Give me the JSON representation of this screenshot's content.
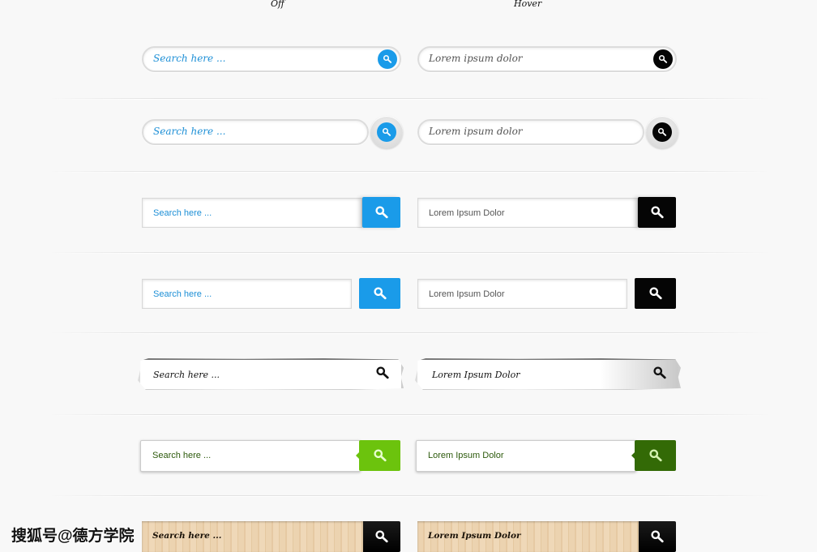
{
  "headers": {
    "off": "Off",
    "hover": "Hover"
  },
  "colors": {
    "blue": "#1a9be9",
    "black": "#050505",
    "green_off": "#6cc30d",
    "green_hover": "#336a06",
    "text_blue": "#1d8fd6",
    "text_gray": "#555555",
    "text_green": "#2d5a0c"
  },
  "rows": [
    {
      "style": "pill-inner-button",
      "off": {
        "text": "Search here ...",
        "icon": "search-icon"
      },
      "hover": {
        "text": "Lorem ipsum dolor",
        "icon": "search-icon"
      }
    },
    {
      "style": "pill-outer-round-button",
      "off": {
        "text": "Search here ...",
        "icon": "search-icon"
      },
      "hover": {
        "text": "Lorem ipsum dolor",
        "icon": "search-icon"
      }
    },
    {
      "style": "flat-attached-button",
      "off": {
        "text": "Search here ...",
        "icon": "search-icon"
      },
      "hover": {
        "text": "Lorem Ipsum Dolor",
        "icon": "search-icon"
      }
    },
    {
      "style": "flat-detached-button",
      "off": {
        "text": "Search here ...",
        "icon": "search-icon"
      },
      "hover": {
        "text": "Lorem Ipsum Dolor",
        "icon": "search-icon"
      }
    },
    {
      "style": "torn-paper",
      "off": {
        "text": "Search here ...",
        "icon": "search-icon"
      },
      "hover": {
        "text": "Lorem Ipsum Dolor",
        "icon": "search-icon"
      }
    },
    {
      "style": "green-arrow-button",
      "off": {
        "text": "Search here ...",
        "icon": "search-icon"
      },
      "hover": {
        "text": "Lorem Ipsum Dolor",
        "icon": "search-icon"
      }
    },
    {
      "style": "wood",
      "off": {
        "text": "Search here ...",
        "icon": "search-icon"
      },
      "hover": {
        "text": "Lorem Ipsum Dolor",
        "icon": "search-icon"
      }
    }
  ],
  "watermark": "搜狐号@德方学院"
}
